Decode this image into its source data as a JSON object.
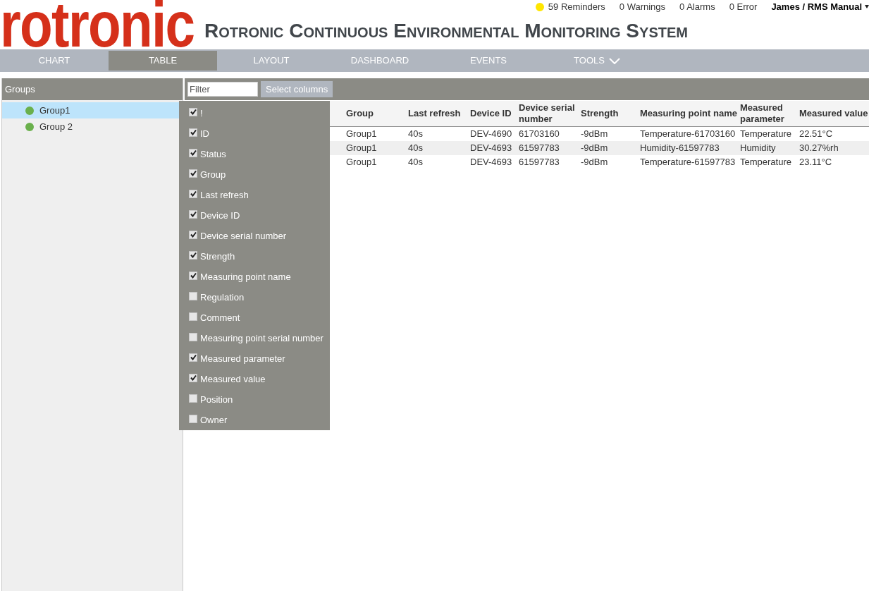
{
  "header": {
    "logo": "rotronic",
    "title": "Rotronic Continuous Environmental Monitoring System",
    "notifications": [
      {
        "label": "59 Reminders",
        "color": "#ffe600"
      },
      {
        "label": "0 Warnings"
      },
      {
        "label": "0 Alarms"
      },
      {
        "label": "0 Error"
      }
    ],
    "user": {
      "label": "James / RMS Manual",
      "menu": true
    }
  },
  "nav": {
    "tabs": [
      {
        "label": "CHART",
        "selected": false,
        "menu": false
      },
      {
        "label": "TABLE",
        "selected": true,
        "menu": false
      },
      {
        "label": "LAYOUT",
        "selected": false,
        "menu": false
      },
      {
        "label": "DASHBOARD",
        "selected": false,
        "menu": false
      },
      {
        "label": "EVENTS",
        "selected": false,
        "menu": false
      },
      {
        "label": "TOOLS",
        "selected": false,
        "menu": true
      }
    ]
  },
  "groups_panel": {
    "title": "Groups",
    "items": [
      {
        "label": "Group1",
        "selected": true,
        "color": "#6ab04c"
      },
      {
        "label": "Group 2",
        "selected": false,
        "color": "#6ab04c"
      }
    ]
  },
  "toolbar": {
    "filter": {
      "placeholder": "Filter"
    },
    "select_columns_button": "Select columns"
  },
  "column_menu": {
    "items": [
      {
        "label": "!",
        "checked": true
      },
      {
        "label": "ID",
        "checked": true
      },
      {
        "label": "Status",
        "checked": true
      },
      {
        "label": "Group",
        "checked": true
      },
      {
        "label": "Last refresh",
        "checked": true
      },
      {
        "label": "Device ID",
        "checked": true
      },
      {
        "label": "Device serial number",
        "checked": true
      },
      {
        "label": "Strength",
        "checked": true
      },
      {
        "label": "Measuring point name",
        "checked": true
      },
      {
        "label": "Regulation",
        "checked": false
      },
      {
        "label": "Comment",
        "checked": false
      },
      {
        "label": "Measuring point serial number",
        "checked": false
      },
      {
        "label": "Measured parameter",
        "checked": true
      },
      {
        "label": "Measured value",
        "checked": true
      },
      {
        "label": "Position",
        "checked": false
      },
      {
        "label": "Owner",
        "checked": false
      }
    ]
  },
  "table": {
    "columns": [
      "Group",
      "Last refresh",
      "Device ID",
      "Device serial number",
      "Strength",
      "Measuring point name",
      "Measured parameter",
      "Measured value"
    ],
    "rows": [
      [
        "Group1",
        "40s",
        "DEV-4690",
        "61703160",
        "-9dBm",
        "Temperature-61703160",
        "Temperature",
        "22.51°C"
      ],
      [
        "Group1",
        "40s",
        "DEV-4693",
        "61597783",
        "-9dBm",
        "Humidity-61597783",
        "Humidity",
        "30.27%rh"
      ],
      [
        "Group1",
        "40s",
        "DEV-4693",
        "61597783",
        "-9dBm",
        "Temperature-61597783",
        "Temperature",
        "23.11°C"
      ]
    ]
  }
}
